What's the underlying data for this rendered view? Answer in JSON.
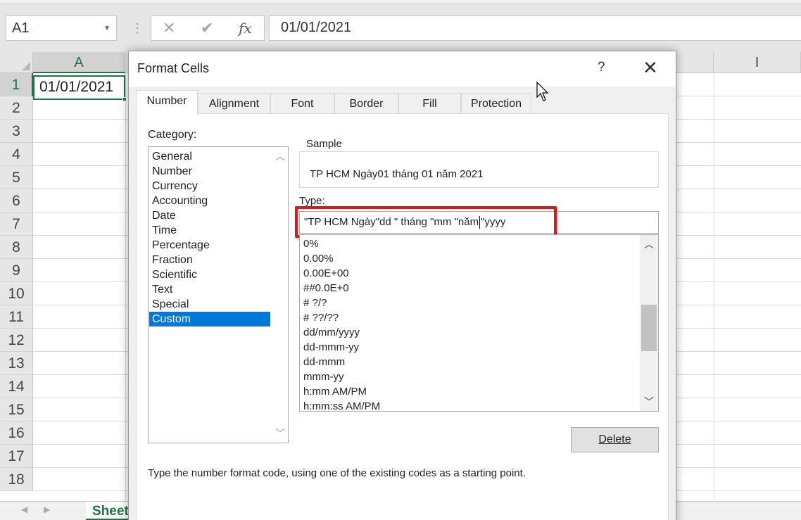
{
  "formula_bar": {
    "name_box": "A1",
    "formula": "01/01/2021",
    "cancel_icon": "✕",
    "enter_icon": "✔",
    "fx_label": "fx"
  },
  "sheet": {
    "columns": [
      "A",
      "I"
    ],
    "rows": [
      "1",
      "2",
      "3",
      "4",
      "5",
      "6",
      "7",
      "8",
      "9",
      "10",
      "11",
      "12",
      "13",
      "14",
      "15",
      "16",
      "17",
      "18"
    ],
    "active_cell_value": "01/01/2021",
    "sheet_tab": "Sheet"
  },
  "dialog": {
    "title": "Format Cells",
    "help": "?",
    "close": "✕",
    "tabs": [
      {
        "label": "Number",
        "active": true
      },
      {
        "label": "Alignment"
      },
      {
        "label": "Font"
      },
      {
        "label": "Border"
      },
      {
        "label": "Fill"
      },
      {
        "label": "Protection"
      }
    ],
    "category_label": "Category:",
    "categories": [
      "General",
      "Number",
      "Currency",
      "Accounting",
      "Date",
      "Time",
      "Percentage",
      "Fraction",
      "Scientific",
      "Text",
      "Special",
      "Custom"
    ],
    "selected_category": "Custom",
    "sample_label": "Sample",
    "sample_text": "TP HCM Ngày01  tháng 01 năm 2021",
    "type_label": "Type:",
    "type_value_before_caret": "\"TP HCM Ngày\"dd \" tháng \"mm \"năm",
    "type_value_after_caret": "\"yyyy",
    "format_codes": [
      "0%",
      "0.00%",
      "0.00E+00",
      "##0.0E+0",
      "# ?/?",
      "# ??/??",
      "dd/mm/yyyy",
      "dd-mmm-yy",
      "dd-mmm",
      "mmm-yy",
      "h:mm AM/PM",
      "h:mm:ss AM/PM"
    ],
    "delete_button": "Delete",
    "hint": "Type the number format code, using one of the existing codes as a starting point."
  },
  "colors": {
    "excel_green": "#217346",
    "highlight_red": "#d6191f",
    "selection_blue": "#0078d7"
  }
}
